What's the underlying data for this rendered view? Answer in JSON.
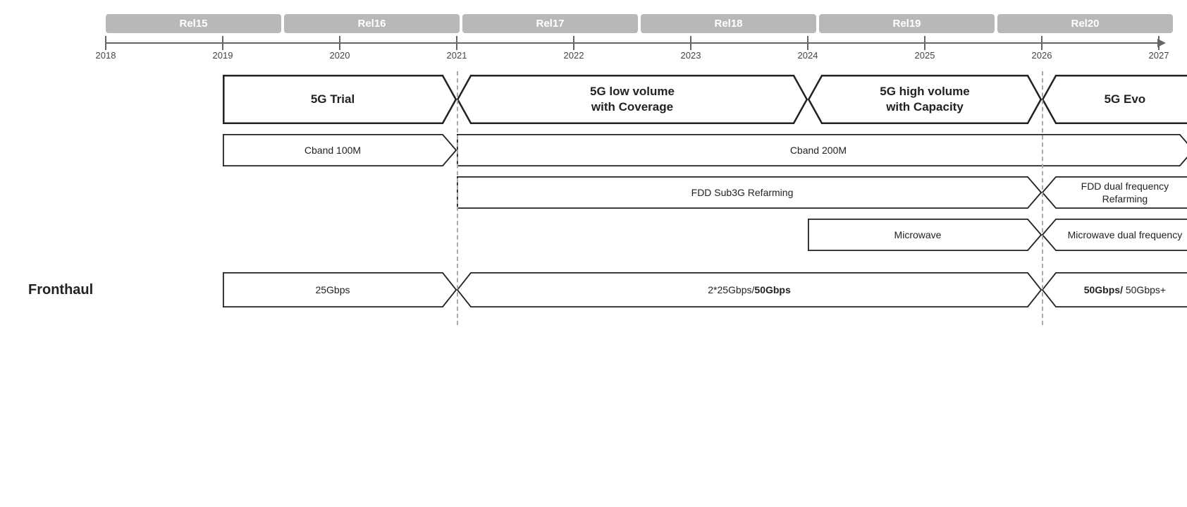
{
  "releases": [
    {
      "label": "Rel15",
      "widthPct": 16
    },
    {
      "label": "Rel16",
      "widthPct": 16
    },
    {
      "label": "Rel17",
      "widthPct": 16
    },
    {
      "label": "Rel18",
      "widthPct": 16
    },
    {
      "label": "Rel19",
      "widthPct": 16
    },
    {
      "label": "Rel20",
      "widthPct": 16
    }
  ],
  "years": [
    "2018",
    "2019",
    "2020",
    "2021",
    "2022",
    "2023",
    "2024",
    "2025",
    "2026",
    "2027"
  ],
  "row1": {
    "items": [
      {
        "text": "5G Trial",
        "bold": true,
        "startPct": 8,
        "widthPct": 18,
        "shape": "arrow-right"
      },
      {
        "text": "5G low volume\nwith Coverage",
        "bold": true,
        "startPct": 26,
        "widthPct": 22,
        "shape": "arrow-both"
      },
      {
        "text": "5G high volume\nwith Capacity",
        "bold": true,
        "startPct": 48,
        "widthPct": 25,
        "shape": "arrow-both"
      },
      {
        "text": "5G Evo",
        "bold": true,
        "startPct": 73,
        "widthPct": 24,
        "shape": "arrow-left"
      }
    ]
  },
  "row2": {
    "items": [
      {
        "text": "Cband 100M",
        "startPct": 8,
        "widthPct": 18,
        "shape": "arrow-right"
      },
      {
        "text": "Cband 200M",
        "startPct": 26,
        "widthPct": 71,
        "shape": "arrow-right"
      }
    ]
  },
  "row3": {
    "items": [
      {
        "text": "FDD Sub3G Refarming",
        "startPct": 26,
        "widthPct": 47,
        "shape": "arrow-right"
      },
      {
        "text": "FDD dual frequency Refarming",
        "startPct": 73,
        "widthPct": 24,
        "shape": "arrow-left"
      }
    ]
  },
  "row4": {
    "items": [
      {
        "text": "Microwave",
        "startPct": 48,
        "widthPct": 25,
        "shape": "arrow-right"
      },
      {
        "text": "Microwave dual frequency",
        "startPct": 73,
        "widthPct": 24,
        "shape": "arrow-left"
      }
    ]
  },
  "row5": {
    "label": "Fronthaul",
    "items": [
      {
        "text": "25Gbps",
        "startPct": 8,
        "widthPct": 18,
        "shape": "arrow-right"
      },
      {
        "text": "2*25Gbps/50Gbps",
        "startPct": 26,
        "widthPct": 47,
        "shape": "arrow-both",
        "boldPart": "50Gbps"
      },
      {
        "text": "50Gbps/ 50Gbps+",
        "startPct": 73,
        "widthPct": 24,
        "shape": "arrow-left",
        "boldPart": "50Gbps/"
      }
    ]
  },
  "colors": {
    "release_bg": "#c0c0c0",
    "release_text": "#ffffff",
    "arrow_border": "#222222",
    "axis_color": "#666666",
    "year_color": "#444444",
    "dashed_color": "#aaaaaa",
    "text_dark": "#222222"
  },
  "dashed_lines_pct": [
    26,
    73
  ]
}
